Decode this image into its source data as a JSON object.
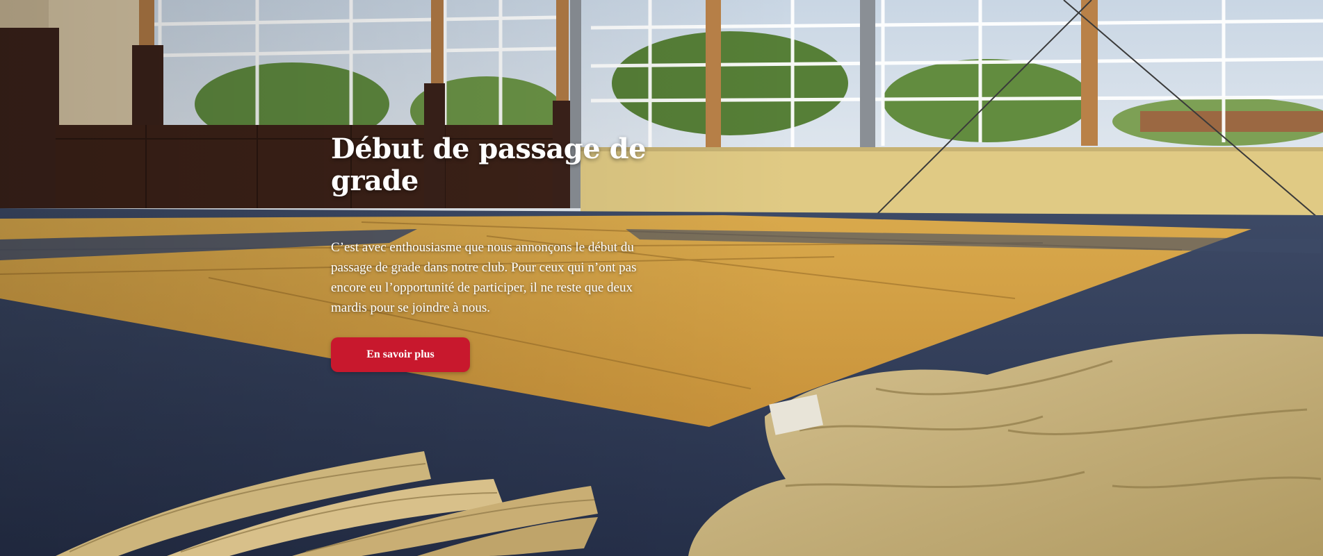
{
  "hero": {
    "background_icon": "photo-dojo-tatami",
    "title": "Début de passage de grade",
    "description": "C’est avec enthousiasme que nous annonçons le début du passage de grade dans notre club. Pour ceux qui n’ont pas encore eu l’opportunité de participer, il ne reste que deux mardis pour se joindre à nous.",
    "cta_label": "En savoir plus"
  },
  "colors": {
    "accent": "#c8182d",
    "text": "#ffffff"
  }
}
